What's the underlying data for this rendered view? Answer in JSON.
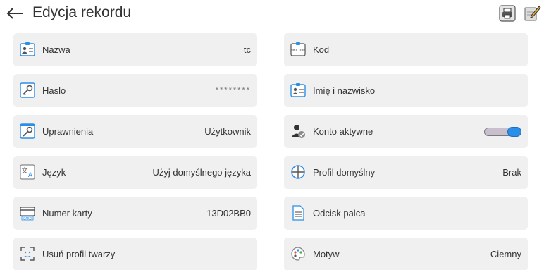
{
  "header": {
    "title": "Edycja rekordu"
  },
  "fields": [
    {
      "label": "Nazwa",
      "value": "tc"
    },
    {
      "label": "Kod",
      "value": ""
    },
    {
      "label": "Haslo",
      "value": "********"
    },
    {
      "label": "Imię i nazwisko",
      "value": ""
    },
    {
      "label": "Uprawnienia",
      "value": "Użytkownik"
    },
    {
      "label": "Konto aktywne",
      "value": "",
      "toggle_on": true
    },
    {
      "label": "Język",
      "value": "Użyj domyślnego języka"
    },
    {
      "label": "Profil domyślny",
      "value": "Brak"
    },
    {
      "label": "Numer karty",
      "value": "13D02BB0"
    },
    {
      "label": "Odcisk palca",
      "value": ""
    },
    {
      "label": "Usuń profil twarzy",
      "value": ""
    },
    {
      "label": "Motyw",
      "value": "Ciemny"
    }
  ],
  "icons": {
    "card_text": "CARD",
    "code_text": "001 100"
  },
  "colors": {
    "accent": "#2b8fe8",
    "tile_bg": "#f0f0f0"
  }
}
